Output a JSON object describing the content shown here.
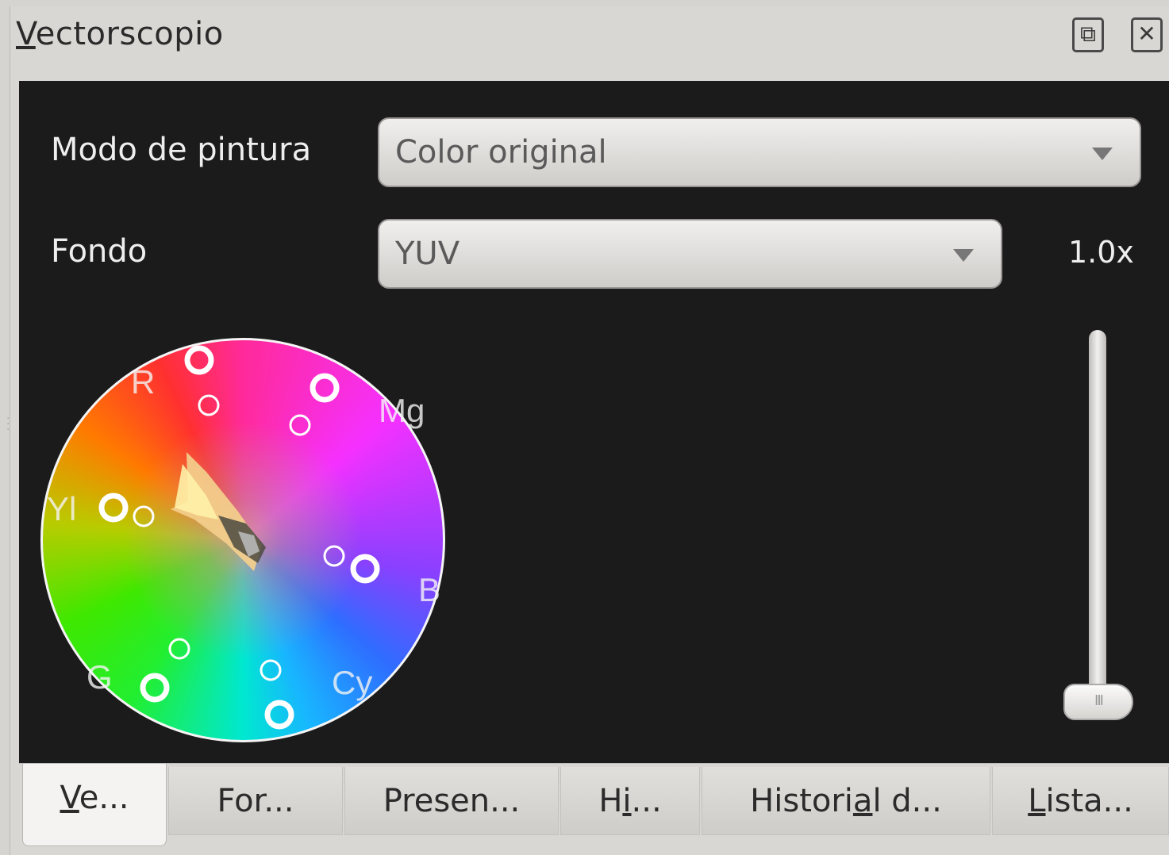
{
  "window": {
    "title_mnemonic": "V",
    "title_rest": "ectorscopio",
    "float_icon": "⧉",
    "close_icon": "✕"
  },
  "settings": {
    "paint_mode_label": "Modo de pintura",
    "paint_mode_value": "Color original",
    "background_label": "Fondo",
    "background_value": "YUV",
    "zoom_value": "1.0x"
  },
  "scope": {
    "labels": {
      "red": "R",
      "magenta": "Mg",
      "yellow": "Yl",
      "blue": "B",
      "green": "G",
      "cyan": "Cy"
    }
  },
  "slider": {
    "grip": "III",
    "level": 0
  },
  "tabs": [
    {
      "pre": "",
      "mn": "V",
      "post": "e..."
    },
    {
      "pre": "For...",
      "mn": "",
      "post": ""
    },
    {
      "pre": "Presen...",
      "mn": "",
      "post": ""
    },
    {
      "pre": "H",
      "mn": "i",
      "post": "..."
    },
    {
      "pre": "Histori",
      "mn": "a",
      "post": "l d..."
    },
    {
      "pre": "",
      "mn": "L",
      "post": "ista..."
    }
  ]
}
